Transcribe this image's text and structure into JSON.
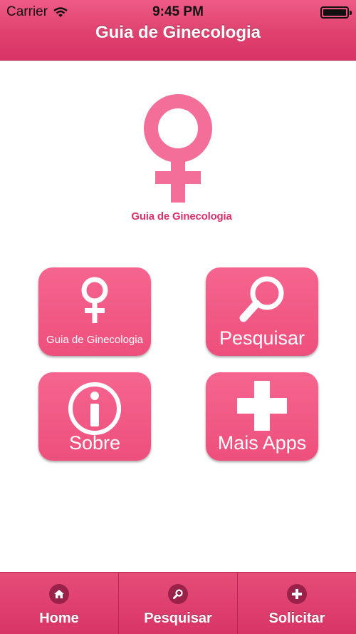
{
  "status_bar": {
    "carrier": "Carrier",
    "time": "9:45 PM"
  },
  "nav": {
    "title": "Guia de Ginecologia"
  },
  "logo": {
    "label": "Guia de Ginecologia"
  },
  "grid": {
    "items": [
      {
        "label": "Guia de Ginecologia",
        "icon": "female-symbol-icon"
      },
      {
        "label": "Pesquisar",
        "icon": "search-icon"
      },
      {
        "label": "Sobre",
        "icon": "info-icon"
      },
      {
        "label": "Mais Apps",
        "icon": "plus-icon"
      }
    ]
  },
  "tabbar": {
    "tabs": [
      {
        "label": "Home",
        "icon": "home-icon"
      },
      {
        "label": "Pesquisar",
        "icon": "search-icon"
      },
      {
        "label": "Solicitar",
        "icon": "plus-icon"
      }
    ]
  },
  "colors": {
    "primary": "#e0416f",
    "tile": "#f25a86",
    "logo": "#f46e9a",
    "tab_icon_bg": "#9a2149"
  }
}
